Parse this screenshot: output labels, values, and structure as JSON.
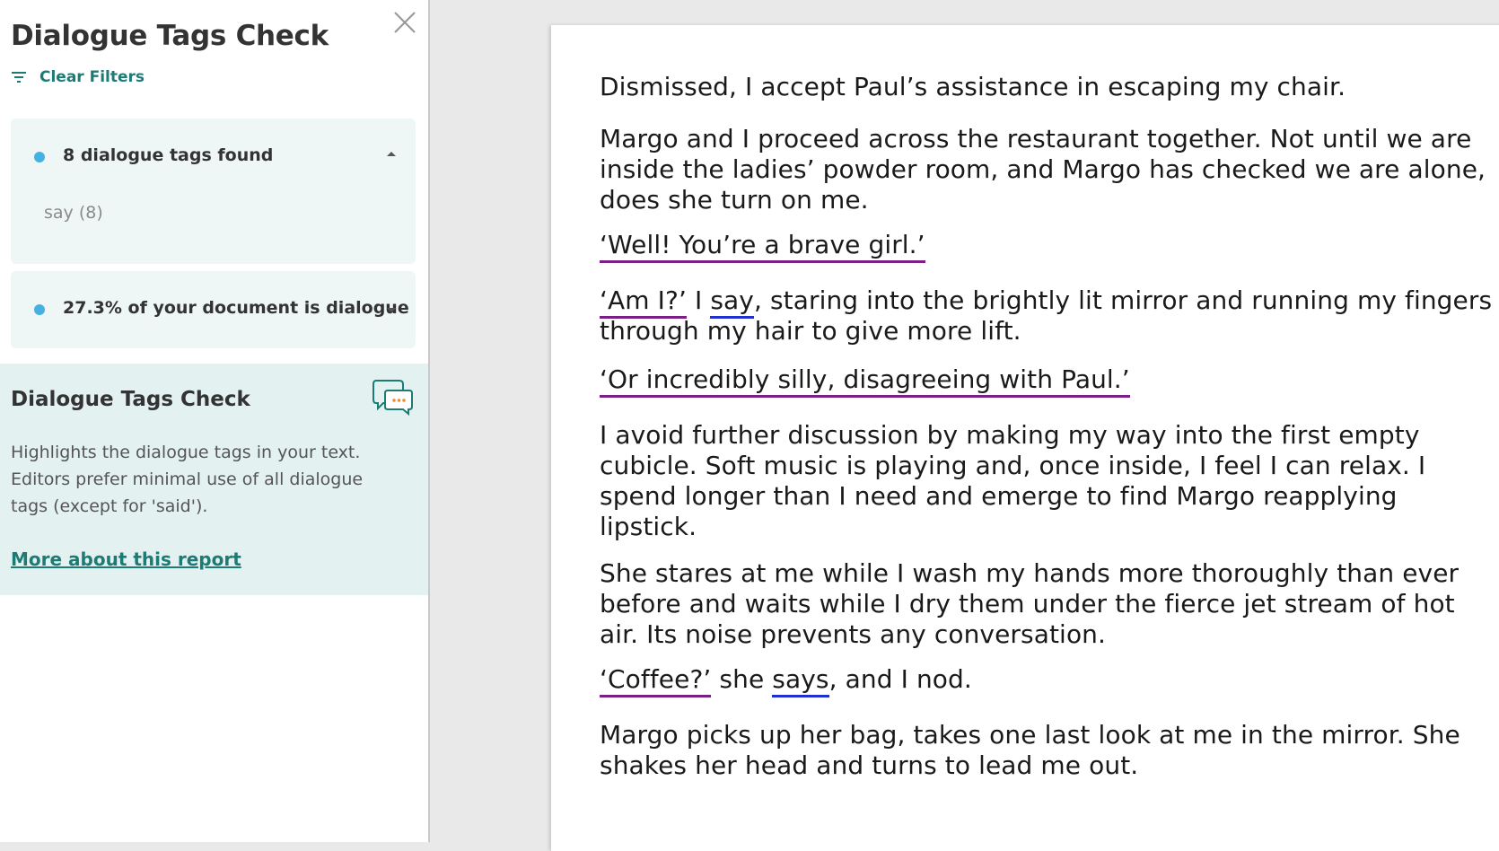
{
  "sidebar": {
    "title": "Dialogue Tags Check",
    "clear_filters": "Clear Filters",
    "tags_card": {
      "title": "8 dialogue tags found",
      "items": [
        "say (8)"
      ]
    },
    "dialogue_card": {
      "title": "27.3% of your document is dialogue"
    },
    "info": {
      "title": "Dialogue Tags Check",
      "description": "Highlights the dialogue tags in your text. Editors prefer minimal use of all dialogue tags (except for 'said').",
      "link": "More about this report"
    }
  },
  "document": {
    "p1": "Dismissed, I accept Paul’s assistance in escaping my chair.",
    "p2": "Margo and I proceed across the restaurant together. Not until we are inside the ladies’ powder room, and Margo has checked we are alone, does she turn on me.",
    "p3_quote": "‘Well! You’re a brave girl.’",
    "p4_quote": "‘Am I?’",
    "p4_mid": " I ",
    "p4_tag": "say",
    "p4_rest": ", staring into the brightly lit mirror and running my fingers through my hair to give more lift.",
    "p5_quote": "‘Or incredibly silly, disagreeing with Paul.’",
    "p6": "I avoid further discussion by making my way into the first empty cubicle. Soft music is playing and, once inside, I feel I can relax. I spend longer than I need and emerge to find Margo reapplying lipstick.",
    "p7": "She stares at me while I wash my hands more thoroughly than ever before and waits while I dry them under the fierce jet stream of hot air. Its noise prevents any conversation.",
    "p8_quote": "‘Coffee?’",
    "p8_mid": " she ",
    "p8_tag": "says",
    "p8_rest": ", and I nod.",
    "p9": "Margo picks up her bag, takes one last look at me in the mirror. She shakes her head and turns to lead me out."
  },
  "colors": {
    "accent": "#1c7c75",
    "dot": "#46b1e1",
    "dialogue_underline": "#7b1f86",
    "tag_underline": "#2030d0"
  },
  "icons": [
    "close-icon",
    "filter-icon",
    "chevron-up-icon",
    "chevron-down-icon",
    "chat-bubbles-icon"
  ]
}
